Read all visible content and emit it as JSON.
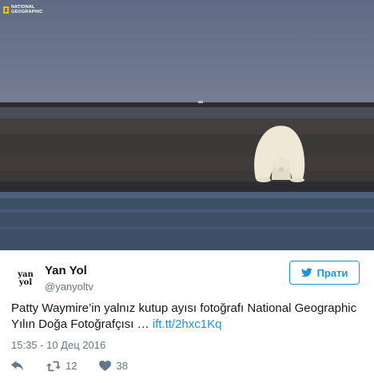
{
  "photo": {
    "logo_text": "NATIONAL\nGEOGRAPHIC",
    "colors": {
      "sky": "#6e7890",
      "water": "#3d4f66",
      "ground": "#3a3736",
      "bear": "#eee7d6"
    }
  },
  "user": {
    "avatar_text": "yan\nyol",
    "display_name": "Yan Yol",
    "handle": "@yanyoltv"
  },
  "follow_button": {
    "label": "Прати",
    "icon": "twitter-bird-icon",
    "color": "#1b95e0"
  },
  "tweet": {
    "text": "Patty Waymire’in yalnız kutup ayısı fotoğrafı National Geographic Yılın Doğa Fotoğrafçısı … ",
    "link": "ift.tt/2hxc1Kq",
    "timestamp": "15:35 - 10 Дец 2016"
  },
  "actions": {
    "reply_icon": "reply-icon",
    "retweet_icon": "retweet-icon",
    "retweet_count": "12",
    "like_icon": "heart-icon",
    "like_count": "38"
  }
}
